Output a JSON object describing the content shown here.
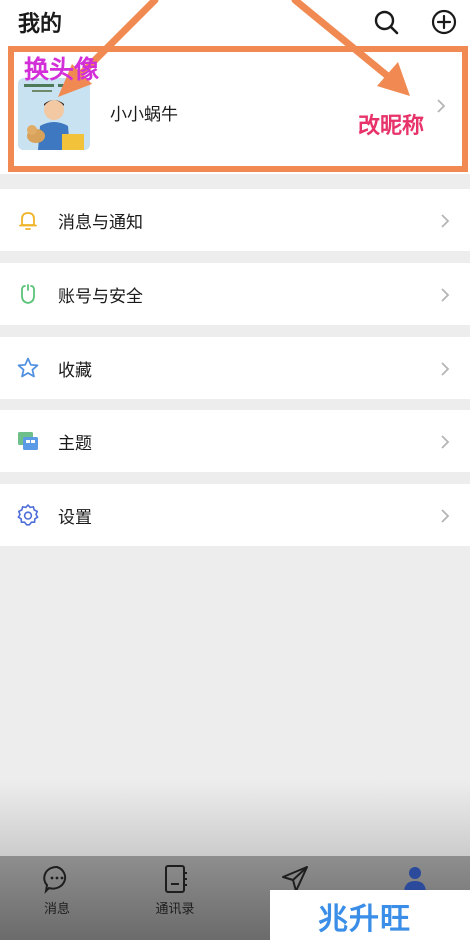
{
  "header": {
    "title": "我的",
    "search_icon": "search-icon",
    "add_icon": "plus-circle-icon"
  },
  "profile": {
    "nickname": "小小蜗牛",
    "avatar_icon": "avatar-photo"
  },
  "annotations": {
    "change_avatar": "换头像",
    "change_nickname": "改昵称",
    "box_color": "#f08a52",
    "avatar_text_color": "#d22fd8",
    "nickname_text_color": "#e8336a"
  },
  "menu": {
    "items": [
      {
        "label": "消息与通知",
        "icon": "bell-icon"
      },
      {
        "label": "账号与安全",
        "icon": "shield-icon"
      },
      {
        "label": "收藏",
        "icon": "star-icon"
      },
      {
        "label": "主题",
        "icon": "theme-icon"
      },
      {
        "label": "设置",
        "icon": "gear-icon"
      }
    ]
  },
  "tabs": [
    {
      "label": "消息",
      "icon": "chat-bubble-icon"
    },
    {
      "label": "通讯录",
      "icon": "contacts-icon"
    },
    {
      "label": "",
      "icon": "send-icon"
    },
    {
      "label": "",
      "icon": "person-icon"
    }
  ],
  "watermark": "兆升旺"
}
